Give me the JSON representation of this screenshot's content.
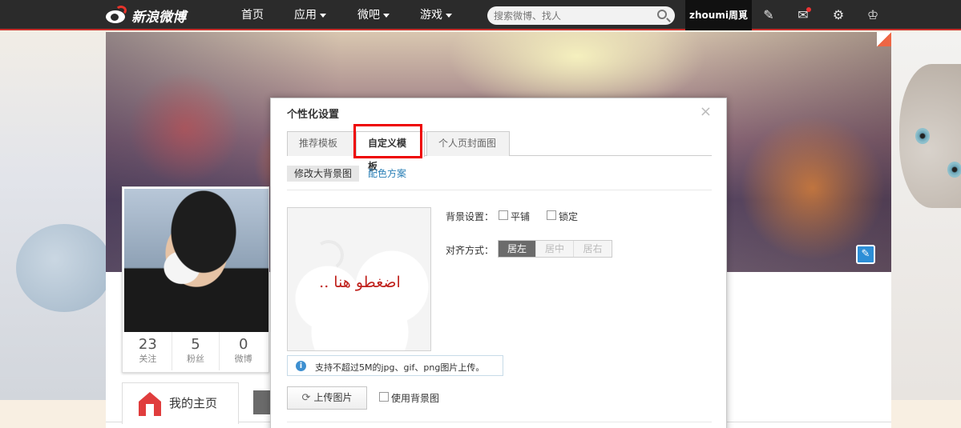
{
  "topbar": {
    "brand": "新浪微博",
    "nav": [
      {
        "label": "首页",
        "has_menu": false
      },
      {
        "label": "应用",
        "has_menu": true
      },
      {
        "label": "微吧",
        "has_menu": true
      },
      {
        "label": "游戏",
        "has_menu": true
      }
    ],
    "search_placeholder": "搜索微博、找人",
    "username": "zhoumi周覓",
    "icons": [
      "compose-icon",
      "message-icon",
      "settings-icon",
      "account-icon"
    ]
  },
  "profile": {
    "stats": [
      {
        "value": "23",
        "label": "关注"
      },
      {
        "value": "5",
        "label": "粉丝"
      },
      {
        "value": "0",
        "label": "微博"
      }
    ],
    "home_tab": "我的主页"
  },
  "dialog": {
    "title": "个性化设置",
    "close": "×",
    "tabs": [
      "推荐模板",
      "自定义模板",
      "个人页封面图"
    ],
    "active_tab": 1,
    "subnav": {
      "active": "修改大背景图",
      "link": "配色方案"
    },
    "preview_text": "اضغطو هنا ..",
    "background_setting": {
      "label": "背景设置：",
      "options": [
        "平铺",
        "锁定"
      ]
    },
    "alignment": {
      "label": "对齐方式：",
      "options": [
        "居左",
        "居中",
        "居右"
      ],
      "selected": "居左"
    },
    "tip": "支持不超过5M的jpg、gif、png图片上传。",
    "upload_button": "上传图片",
    "use_bg_label": "使用背景图"
  },
  "colors": {
    "accent_red": "#e00000",
    "topbar_bg": "#2b2b2b",
    "link_blue": "#2a7fb6",
    "segment_selected": "#6b6b6b"
  }
}
